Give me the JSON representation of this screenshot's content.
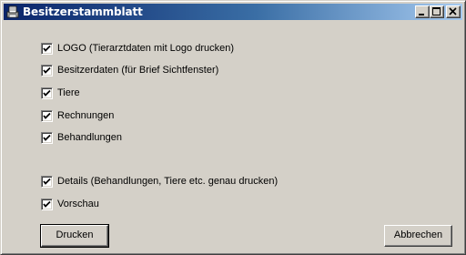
{
  "window": {
    "title": "Besitzerstammblatt"
  },
  "options": [
    {
      "label": "LOGO (Tierarztdaten mit Logo drucken)",
      "checked": true
    },
    {
      "label": "Besitzerdaten (für Brief Sichtfenster)",
      "checked": true
    },
    {
      "label": "Tiere",
      "checked": true
    },
    {
      "label": "Rechnungen",
      "checked": true
    },
    {
      "label": "Behandlungen",
      "checked": true
    },
    {
      "label": "Details (Behandlungen, Tiere etc. genau drucken)",
      "checked": true
    },
    {
      "label": "Vorschau",
      "checked": true
    }
  ],
  "buttons": {
    "print": "Drucken",
    "cancel": "Abbrechen"
  }
}
